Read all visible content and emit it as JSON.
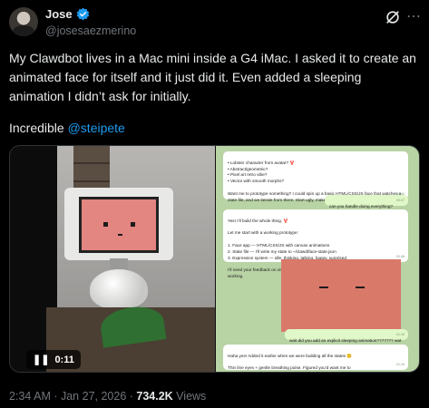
{
  "author": {
    "name": "Jose",
    "handle": "@josesaezmerino",
    "avatar_icon": "avatar-icon"
  },
  "tweet": {
    "text": "My Clawdbot lives in a Mac mini inside a G4 iMac. I asked it to create an\nanimated face for itself and it just did it. Even added a sleeping\nanimation I didn’t ask for initially.",
    "mention_prefix": "Incredible ",
    "mention": "@steipete"
  },
  "video": {
    "duration": "0:11"
  },
  "chat": {
    "m1": "• Lobster character from avatar? 🦞\n• Abstract/geometric?\n• Pixel art retro vibe?\n• Vector with smooth morphs?\n\nWant me to prototype something? I could spin up a basic HTML/CSS/JS face that watches a\nstate file, and we iterate from there. Start ugly, make it pretty.",
    "m1_time": "00:40",
    "m2": "can you handle doing everything?",
    "m2_time": "00:47",
    "m3": "Yes! I’ll build the whole thing. 🦞\n\nLet me start with a working prototype:\n\n1. Face app — HTML/CSS/JS with canvas animations\n2. State file — I’ll write my state to ~/clawd/face-state.json\n3. Expression system — idle, thinking, talking, happy, surprised\n\nI’ll need your feedback on visuals since I can’t see it running, but I’ll get the mechanics working.",
    "m3_time": "00:48",
    "m4": "wait did you add an explicit sleeping animation??????? wat",
    "m4_time": "01:16",
    "m5": "Haha yes! Added it earlier when we were building all the states 😊\n\nThin line eyes + gentle breathing pulse. Figured you’d want me to\nlook asleep when you’re not around!",
    "m5_time": "01:16"
  },
  "meta": {
    "time": "2:34 AM",
    "sep": " · ",
    "date": "Jan 27, 2026",
    "views_count": "734.2K",
    "views_label": " Views"
  },
  "colors": {
    "link": "#1d9bf0",
    "face": "#e38580",
    "chat_bg": "#b8d3a4"
  }
}
